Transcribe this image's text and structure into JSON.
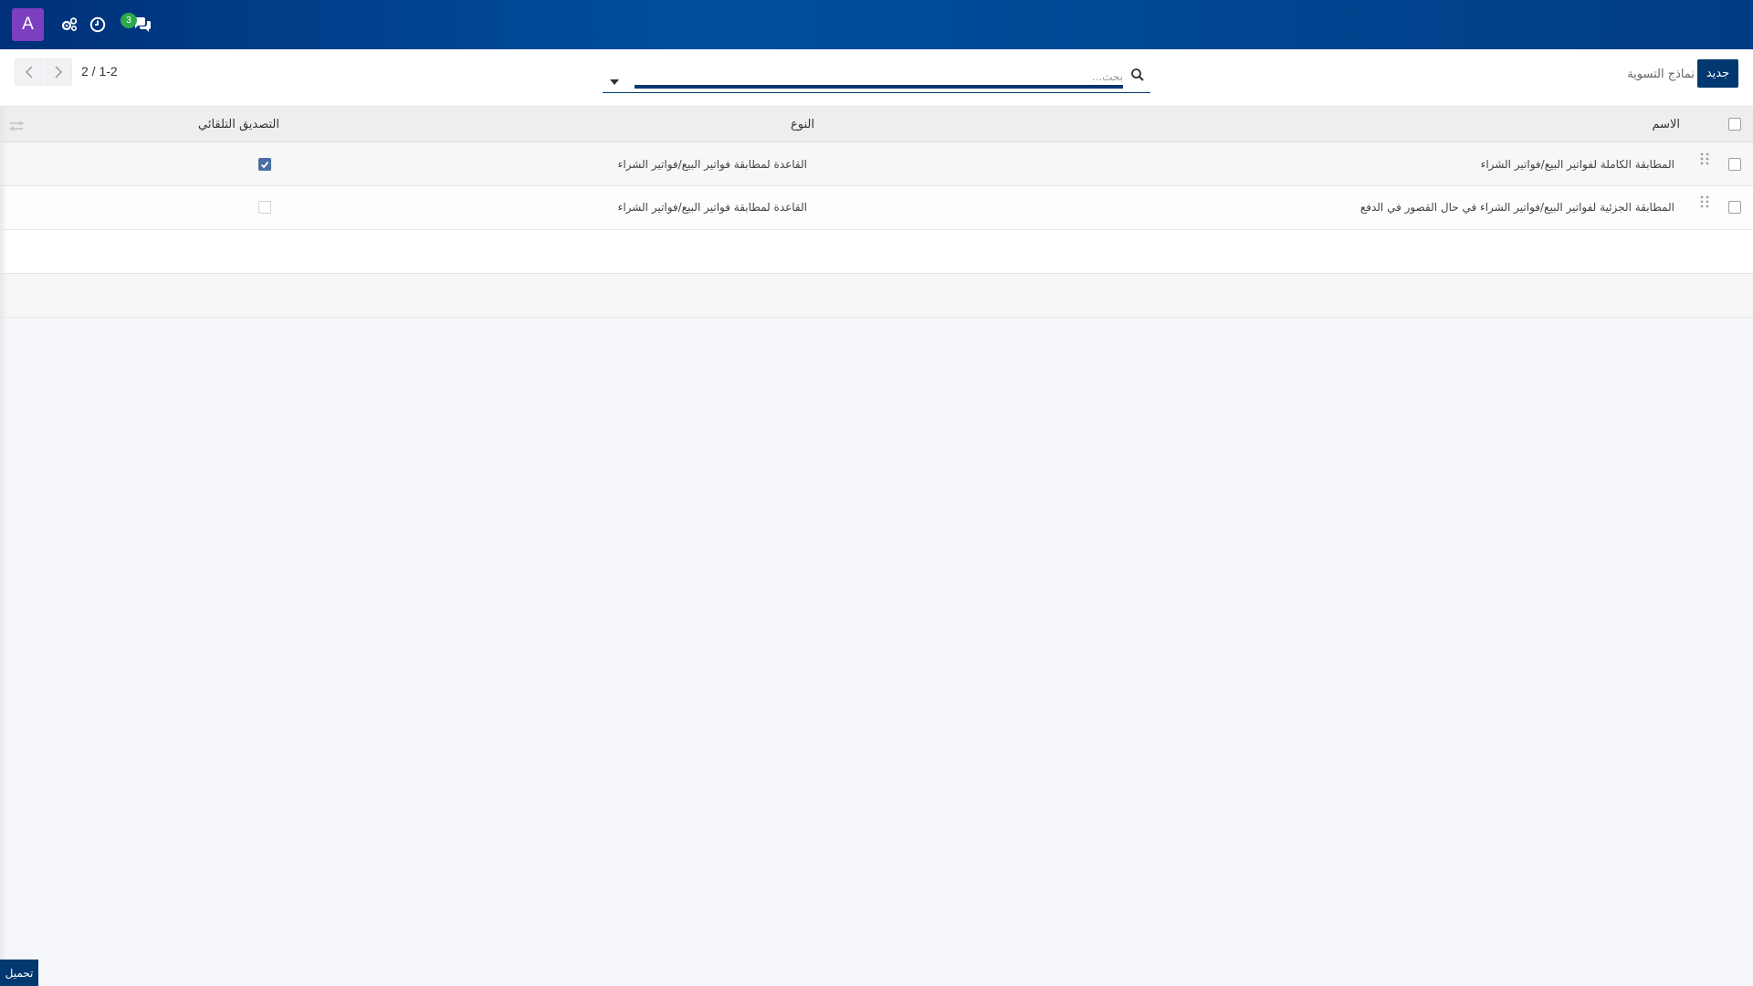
{
  "navbar": {
    "avatar_letter": "A",
    "chat_count": "3",
    "accent_color": "#00509e",
    "avatar_color": "#7b3fbf",
    "badge_color": "#2ea94a"
  },
  "control_panel": {
    "new_button": "جديد",
    "breadcrumb": "نماذج التسوية",
    "search_placeholder": "بحث...",
    "pager_text": "1-2 / 2"
  },
  "table": {
    "headers": {
      "name": "الاسم",
      "type": "النوع",
      "auto_validate": "التصديق التلقائي"
    },
    "rows": [
      {
        "name": "المطابقة الكاملة لفواتير البيع/فواتير الشراء",
        "type": "القاعدة لمطابقة فواتير البيع/فواتير الشراء",
        "auto_validate": true
      },
      {
        "name": "المطابقة الجزئية لفواتير البيع/فواتير الشراء في حال القصور في الدفع",
        "type": "القاعدة لمطابقة فواتير البيع/فواتير الشراء",
        "auto_validate": false
      }
    ]
  },
  "footer": {
    "load_button": "تحميل"
  }
}
